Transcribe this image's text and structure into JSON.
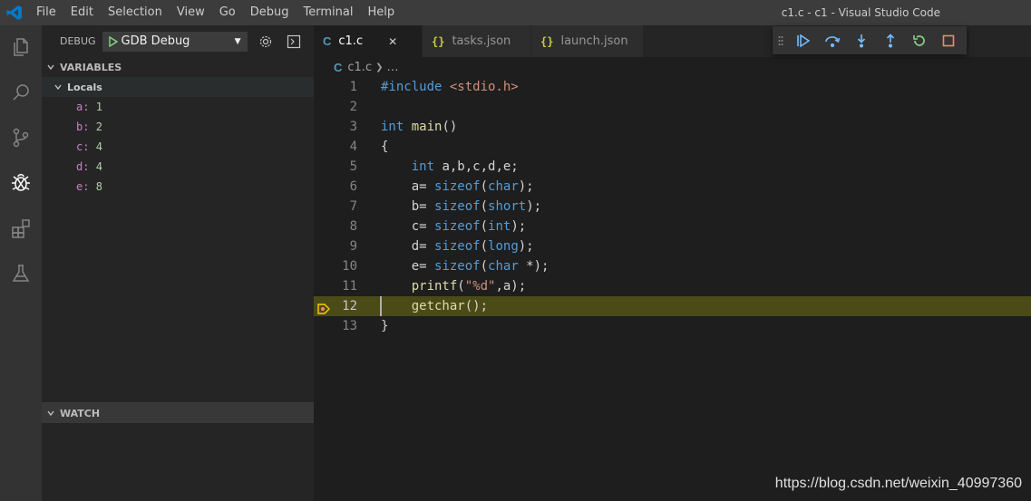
{
  "window": {
    "title": "c1.c - c1 - Visual Studio Code"
  },
  "menu": [
    "File",
    "Edit",
    "Selection",
    "View",
    "Go",
    "Debug",
    "Terminal",
    "Help"
  ],
  "activity_bar": [
    {
      "name": "explorer-icon",
      "active": false
    },
    {
      "name": "search-icon",
      "active": false
    },
    {
      "name": "source-control-icon",
      "active": false
    },
    {
      "name": "debug-icon",
      "active": true
    },
    {
      "name": "extensions-icon",
      "active": false
    },
    {
      "name": "test-icon",
      "active": false
    }
  ],
  "sidebar": {
    "debug_label": "DEBUG",
    "configuration": "GDB Debug",
    "variables_title": "VARIABLES",
    "scope": "Locals",
    "variables": [
      {
        "name": "a",
        "value": "1"
      },
      {
        "name": "b",
        "value": "2"
      },
      {
        "name": "c",
        "value": "4"
      },
      {
        "name": "d",
        "value": "4"
      },
      {
        "name": "e",
        "value": "8"
      }
    ],
    "watch_title": "WATCH"
  },
  "tabs": [
    {
      "icon": "C",
      "label": "c1.c",
      "active": true
    },
    {
      "icon": "{}",
      "label": "tasks.json",
      "active": false
    },
    {
      "icon": "{}",
      "label": "launch.json",
      "active": false
    }
  ],
  "breadcrumb": {
    "icon": "C",
    "file": "c1.c",
    "rest": "…"
  },
  "editor": {
    "current_line": 12,
    "lines": [
      [
        [
          "pp",
          "#include "
        ],
        [
          "inc",
          "<stdio.h>"
        ]
      ],
      [],
      [
        [
          "kw",
          "int"
        ],
        [
          "plain",
          " "
        ],
        [
          "fn",
          "main"
        ],
        [
          "plain",
          "()"
        ]
      ],
      [
        [
          "plain",
          "{"
        ]
      ],
      [
        [
          "plain",
          "    "
        ],
        [
          "kw",
          "int"
        ],
        [
          "plain",
          " a,b,c,d,e;"
        ]
      ],
      [
        [
          "plain",
          "    a= "
        ],
        [
          "kw",
          "sizeof"
        ],
        [
          "plain",
          "("
        ],
        [
          "kw",
          "char"
        ],
        [
          "plain",
          ");"
        ]
      ],
      [
        [
          "plain",
          "    b= "
        ],
        [
          "kw",
          "sizeof"
        ],
        [
          "plain",
          "("
        ],
        [
          "kw",
          "short"
        ],
        [
          "plain",
          ");"
        ]
      ],
      [
        [
          "plain",
          "    c= "
        ],
        [
          "kw",
          "sizeof"
        ],
        [
          "plain",
          "("
        ],
        [
          "kw",
          "int"
        ],
        [
          "plain",
          ");"
        ]
      ],
      [
        [
          "plain",
          "    d= "
        ],
        [
          "kw",
          "sizeof"
        ],
        [
          "plain",
          "("
        ],
        [
          "kw",
          "long"
        ],
        [
          "plain",
          ");"
        ]
      ],
      [
        [
          "plain",
          "    e= "
        ],
        [
          "kw",
          "sizeof"
        ],
        [
          "plain",
          "("
        ],
        [
          "kw",
          "char"
        ],
        [
          "plain",
          " *);"
        ]
      ],
      [
        [
          "plain",
          "    "
        ],
        [
          "fn",
          "printf"
        ],
        [
          "plain",
          "("
        ],
        [
          "str",
          "\"%d\""
        ],
        [
          "plain",
          ",a);"
        ]
      ],
      [
        [
          "plain",
          "    "
        ],
        [
          "fn",
          "getchar"
        ],
        [
          "plain",
          "();"
        ]
      ],
      [
        [
          "plain",
          "}"
        ]
      ]
    ]
  },
  "debug_toolbar": [
    "continue-icon",
    "step-over-icon",
    "step-into-icon",
    "step-out-icon",
    "restart-icon",
    "stop-icon"
  ],
  "colors": {
    "accent": "#007acc",
    "current_line": "#4b4b18",
    "continue": "#75beff",
    "restart": "#89d185",
    "stop": "#f48771",
    "breakpoint_marker": "#ffcc00"
  },
  "watermark": "https://blog.csdn.net/weixin_40997360"
}
